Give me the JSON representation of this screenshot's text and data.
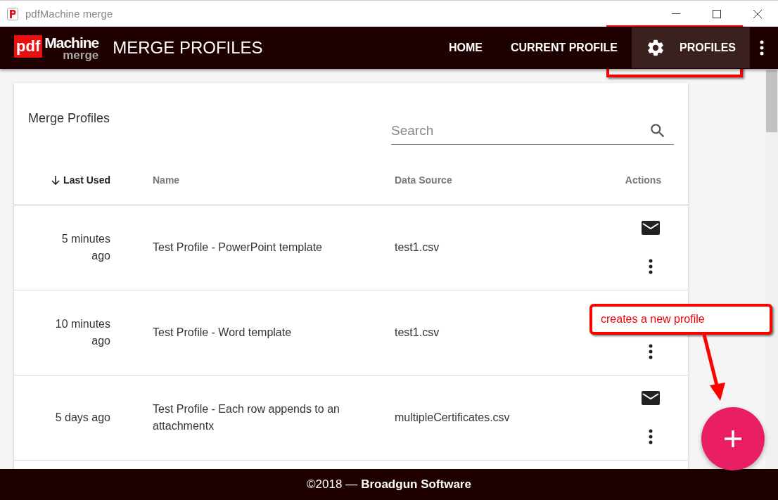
{
  "window": {
    "title": "pdfMachine merge"
  },
  "app_bar": {
    "logo": {
      "pdf": "pdf",
      "machine": "Machine",
      "merge": "merge"
    },
    "title": "MERGE PROFILES",
    "nav": [
      {
        "label": "HOME",
        "selected": false,
        "kind": "text"
      },
      {
        "label": "CURRENT PROFILE",
        "selected": false,
        "kind": "text"
      },
      {
        "label": "PROFILES",
        "selected": true,
        "kind": "settings"
      }
    ]
  },
  "card": {
    "title": "Merge Profiles",
    "search": {
      "placeholder": "Search"
    },
    "columns": [
      {
        "label": "Last Used",
        "sorted": true
      },
      {
        "label": "Name",
        "sorted": false
      },
      {
        "label": "Data Source",
        "sorted": false
      },
      {
        "label": "Actions",
        "sorted": false
      }
    ],
    "rows": [
      {
        "last_used": "5 minutes ago",
        "name": "Test Profile - PowerPoint template",
        "data_source": "test1.csv",
        "actions": [
          {
            "kind": "mail"
          },
          {
            "kind": "more"
          }
        ]
      },
      {
        "last_used": "10 minutes ago",
        "name": "Test Profile - Word template",
        "data_source": "test1.csv",
        "actions": [
          {
            "kind": "more"
          }
        ]
      },
      {
        "last_used": "5 days ago",
        "name": "Test Profile - Each row appends to an attachmentx",
        "data_source": "multipleCertificates.csv",
        "actions": [
          {
            "kind": "mail"
          },
          {
            "kind": "more"
          }
        ]
      }
    ]
  },
  "annotation": {
    "callout": "creates a new profile"
  },
  "footer": {
    "copyright": "©2018 —",
    "company": "Broadgun Software"
  }
}
